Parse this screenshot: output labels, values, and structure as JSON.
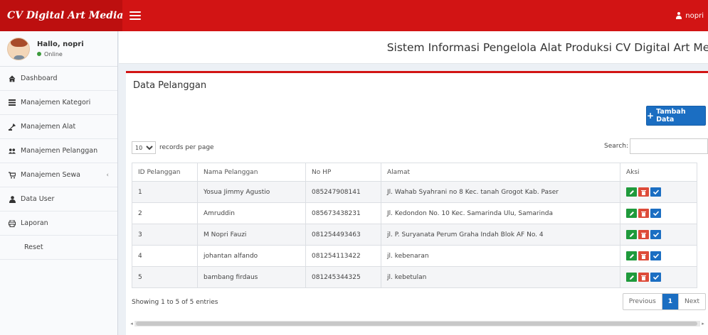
{
  "header": {
    "brand": "CV Digital Art Media",
    "user_name": "nopri"
  },
  "sidebar": {
    "greeting": "Hallo, nopri",
    "status": "Online",
    "items": [
      {
        "label": "Dashboard",
        "icon": "home-icon"
      },
      {
        "label": "Manajemen Kategori",
        "icon": "list-icon"
      },
      {
        "label": "Manajemen Alat",
        "icon": "tools-icon"
      },
      {
        "label": "Manajemen Pelanggan",
        "icon": "users-icon"
      },
      {
        "label": "Manajemen Sewa",
        "icon": "cart-icon",
        "chevron": "‹"
      },
      {
        "label": "Data User",
        "icon": "user-icon"
      },
      {
        "label": "Laporan",
        "icon": "print-icon"
      },
      {
        "label": "Reset",
        "icon": ""
      }
    ]
  },
  "page": {
    "title": "Sistem Informasi Pengelola Alat Produksi CV Digital Art Media"
  },
  "box": {
    "title": "Data Pelanggan",
    "add_button": "Tambah Data",
    "length_value": "10",
    "length_suffix": "records per page",
    "search_label": "Search:",
    "search_value": ""
  },
  "table": {
    "columns": [
      "ID Pelanggan",
      "Nama Pelanggan",
      "No HP",
      "Alamat",
      "Aksi"
    ],
    "rows": [
      [
        "1",
        "Yosua Jimmy Agustio",
        "085247908141",
        "Jl. Wahab Syahrani no 8 Kec. tanah Grogot Kab. Paser"
      ],
      [
        "2",
        "Amruddin",
        "085673438231",
        "Jl. Kedondon No. 10 Kec. Samarinda Ulu, Samarinda"
      ],
      [
        "3",
        "M Nopri Fauzi",
        "081254493463",
        "jl. P. Suryanata Perum Graha Indah Blok AF No. 4"
      ],
      [
        "4",
        "johantan alfando",
        "081254113422",
        "jl. kebenaran"
      ],
      [
        "5",
        "bambang firdaus",
        "081245344325",
        "jl. kebetulan"
      ]
    ]
  },
  "footer": {
    "info": "Showing 1 to 5 of 5 entries",
    "previous": "Previous",
    "current_page": "1",
    "next": "Next"
  },
  "colors": {
    "header": "#d21414",
    "brand_bg": "#bd0f0f",
    "primary": "#1b6ec2",
    "edit": "#1f9a3c",
    "delete": "#dd4b39"
  }
}
